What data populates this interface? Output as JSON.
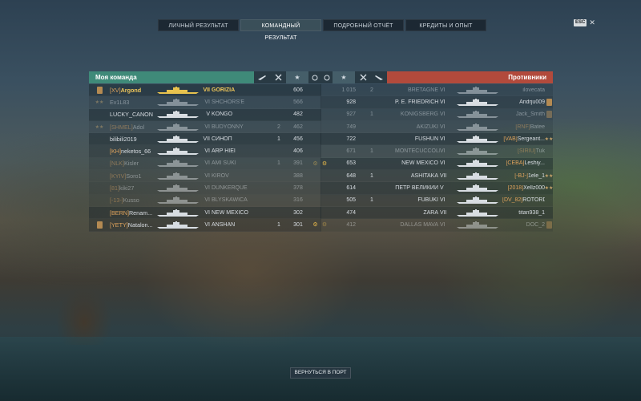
{
  "tabs": [
    {
      "label": "ЛИЧНЫЙ РЕЗУЛЬТАТ",
      "active": false
    },
    {
      "label": "КОМАНДНЫЙ РЕЗУЛЬТАТ",
      "active": true
    },
    {
      "label": "ПОДРОБНЫЙ ОТЧЁТ",
      "active": false
    },
    {
      "label": "КРЕДИТЫ И ОПЫТ",
      "active": false
    }
  ],
  "esc_label": "ESC",
  "close_icon": "close-icon",
  "my_team": {
    "title": "Моя команда",
    "color": "#3f8a79",
    "rows": [
      {
        "badge": "flag",
        "clan": "[XV]",
        "player": "Argond",
        "tier": "VII",
        "ship": "GORIZIA",
        "kills": "",
        "planes": "",
        "xp": "606",
        "ach": false,
        "highlight": true,
        "dead": false
      },
      {
        "badge": "star",
        "clan": "",
        "player": "Ev1L83",
        "tier": "VI",
        "ship": "SHCHORS'E",
        "kills": "",
        "planes": "",
        "xp": "566",
        "ach": false,
        "highlight": false,
        "dead": true
      },
      {
        "badge": "",
        "clan": "",
        "player": "LUCKY_CANON",
        "tier": "V",
        "ship": "KONGŌ",
        "kills": "",
        "planes": "",
        "xp": "482",
        "ach": false,
        "highlight": false,
        "dead": false
      },
      {
        "badge": "star",
        "clan": "[SHMEL]",
        "player": "Adol",
        "tier": "VI",
        "ship": "BUDYONNY",
        "kills": "2",
        "planes": "",
        "xp": "462",
        "ach": false,
        "highlight": false,
        "dead": true
      },
      {
        "badge": "",
        "clan": "",
        "player": "bilibili2019",
        "tier": "VII",
        "ship": "СИНОП",
        "kills": "1",
        "planes": "",
        "xp": "456",
        "ach": false,
        "highlight": false,
        "dead": false
      },
      {
        "badge": "",
        "clan": "[KH]",
        "player": "neketos_66",
        "tier": "VI",
        "ship": "ARP HIEI",
        "kills": "",
        "planes": "",
        "xp": "406",
        "ach": false,
        "highlight": false,
        "dead": false
      },
      {
        "badge": "",
        "clan": "[NLK]",
        "player": "Kisler",
        "tier": "VI",
        "ship": "AMI SUKI",
        "kills": "1",
        "planes": "",
        "xp": "391",
        "ach": true,
        "highlight": false,
        "dead": true
      },
      {
        "badge": "",
        "clan": "[KYIV]",
        "player": "Soro1",
        "tier": "VI",
        "ship": "KIROV",
        "kills": "",
        "planes": "",
        "xp": "388",
        "ach": false,
        "highlight": false,
        "dead": true
      },
      {
        "badge": "",
        "clan": "[81]",
        "player": "kiki27",
        "tier": "VI",
        "ship": "DUNKERQUE",
        "kills": "",
        "planes": "",
        "xp": "378",
        "ach": false,
        "highlight": false,
        "dead": true
      },
      {
        "badge": "",
        "clan": "[-13-]",
        "player": "Kusso",
        "tier": "VI",
        "ship": "BLYSKAWICA",
        "kills": "",
        "planes": "",
        "xp": "316",
        "ach": false,
        "highlight": false,
        "dead": true
      },
      {
        "badge": "",
        "clan": "[BERN]",
        "player": "Renam...",
        "tier": "VI",
        "ship": "NEW MEXICO",
        "kills": "",
        "planes": "",
        "xp": "302",
        "ach": false,
        "highlight": false,
        "dead": false
      },
      {
        "badge": "flag",
        "clan": "[YETY]",
        "player": "Natalon...",
        "tier": "VI",
        "ship": "ANSHAN",
        "kills": "1",
        "planes": "",
        "xp": "301",
        "ach": true,
        "highlight": false,
        "dead": false
      }
    ]
  },
  "enemy_team": {
    "title": "Противники",
    "color": "#b24a3c",
    "rows": [
      {
        "ach": false,
        "xp": "1 015",
        "kills": "2",
        "planes": "",
        "ship": "BRETAGNE",
        "tier": "VI",
        "player": "ilovecata",
        "clan": "",
        "badge": "",
        "dead": true
      },
      {
        "ach": false,
        "xp": "928",
        "kills": "",
        "planes": "",
        "ship": "P. E. FRIEDRICH",
        "tier": "VI",
        "player": "Andrju009",
        "clan": "",
        "badge": "flag",
        "dead": false
      },
      {
        "ach": false,
        "xp": "927",
        "kills": "1",
        "planes": "",
        "ship": "KÖNIGSBERG",
        "tier": "VI",
        "player": "Jack_Smith",
        "clan": "",
        "badge": "flag",
        "dead": true
      },
      {
        "ach": false,
        "xp": "749",
        "kills": "",
        "planes": "",
        "ship": "AKIZUKI",
        "tier": "VI",
        "player": "Batee",
        "clan": "[RNF]",
        "badge": "",
        "dead": true
      },
      {
        "ach": false,
        "xp": "722",
        "kills": "",
        "planes": "",
        "ship": "FUSHUN",
        "tier": "VI",
        "player": "Sergeant...",
        "clan": "[VAB]",
        "badge": "star",
        "dead": false
      },
      {
        "ach": false,
        "xp": "671",
        "kills": "1",
        "planes": "",
        "ship": "MONTECUCCOLI",
        "tier": "VI",
        "player": "Tuk",
        "clan": "[SIRIU]",
        "badge": "",
        "dead": true
      },
      {
        "ach": true,
        "xp": "653",
        "kills": "",
        "planes": "",
        "ship": "NEW MEXICO",
        "tier": "VI",
        "player": "Leshiy...",
        "clan": "[CEBA]",
        "badge": "",
        "dead": false
      },
      {
        "ach": false,
        "xp": "648",
        "kills": "1",
        "planes": "",
        "ship": "ASHITAKA",
        "tier": "VII",
        "player": "1ele_1",
        "clan": "[-BJ-]",
        "badge": "star",
        "dead": false
      },
      {
        "ach": false,
        "xp": "614",
        "kills": "",
        "planes": "",
        "ship": "ПЁТР ВЕЛИКИЙ",
        "tier": "V",
        "player": "Xellz000",
        "clan": "[2018]",
        "badge": "star",
        "dead": false
      },
      {
        "ach": false,
        "xp": "505",
        "kills": "1",
        "planes": "",
        "ship": "FUBUKI",
        "tier": "VI",
        "player": "ROTORD",
        "clan": "[DV_82]",
        "badge": "",
        "dead": false
      },
      {
        "ach": false,
        "xp": "474",
        "kills": "",
        "planes": "",
        "ship": "ZARA",
        "tier": "VII",
        "player": "titan938_1",
        "clan": "",
        "badge": "",
        "dead": false
      },
      {
        "ach": true,
        "xp": "412",
        "kills": "",
        "planes": "",
        "ship": "DALLAS MAVA",
        "tier": "VI",
        "player": "DOC_2",
        "clan": "",
        "badge": "flag",
        "dead": true
      }
    ]
  },
  "header_icons": [
    "plane-icon",
    "crossed-swords-icon",
    "star-icon",
    "medal-icon"
  ],
  "back_button": "ВЕРНУТЬСЯ В ПОРТ"
}
